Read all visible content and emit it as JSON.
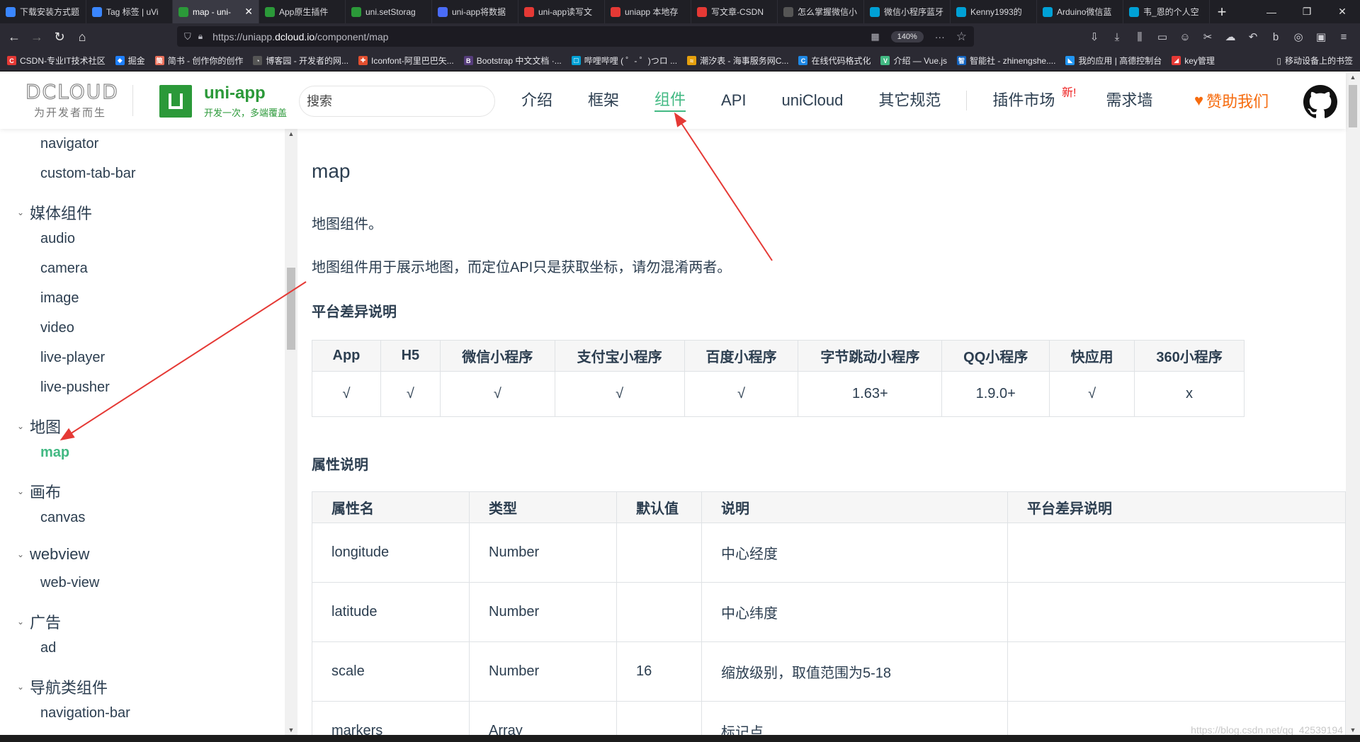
{
  "browser": {
    "tabs": [
      {
        "title": "下载安装方式题",
        "icon_color": "#3a86ff",
        "icon": "shield-icon"
      },
      {
        "title": "Tag 标签 | uVi",
        "icon_color": "#3a86ff",
        "icon": "shield-icon"
      },
      {
        "title": "map - uni-",
        "icon_color": "#2b9939",
        "icon": "uniapp-icon",
        "active": true
      },
      {
        "title": "App原生插件",
        "icon_color": "#2b9939",
        "icon": "uniapp-icon"
      },
      {
        "title": "uni.setStorag",
        "icon_color": "#2b9939",
        "icon": "uniapp-icon"
      },
      {
        "title": "uni-app将数据",
        "icon_color": "#4a6cf7",
        "icon": "paw-icon"
      },
      {
        "title": "uni-app读写文",
        "icon_color": "#e53935",
        "icon": "csdn-icon"
      },
      {
        "title": "uniapp 本地存",
        "icon_color": "#e53935",
        "icon": "csdn-icon"
      },
      {
        "title": "写文章-CSDN",
        "icon_color": "#e53935",
        "icon": "csdn-icon"
      },
      {
        "title": "怎么掌握微信小",
        "icon_color": "#555555",
        "icon": "hat-icon"
      },
      {
        "title": "微信小程序蓝牙",
        "icon_color": "#00a1d6",
        "icon": "bilibili-icon"
      },
      {
        "title": "Kenny1993的",
        "icon_color": "#00a1d6",
        "icon": "bilibili-icon"
      },
      {
        "title": "Arduino微信蓝",
        "icon_color": "#00a1d6",
        "icon": "bilibili-icon"
      },
      {
        "title": "韦_恩的个人空",
        "icon_color": "#00a1d6",
        "icon": "bilibili-icon"
      }
    ],
    "active_tab_close": "✕",
    "new_tab": "+",
    "window_controls": [
      "—",
      "❐",
      "✕"
    ],
    "nav": {
      "back": "←",
      "forward": "→",
      "reload": "↻",
      "home": "⌂"
    },
    "url_prefix": "https://uniapp.",
    "url_domain": "dcloud.io",
    "url_path": "/component/map",
    "zoom": "140%",
    "page_actions": "···",
    "bookmark_star": "☆",
    "toolbar_icons": [
      "⇩",
      "⤓",
      "⫼",
      "▭",
      "☺",
      "✂",
      "☁",
      "↶",
      "b",
      "◎",
      "▣",
      "≡"
    ],
    "bookmarks": [
      {
        "label": "CSDN-专业IT技术社区",
        "color": "#e53935",
        "glyph": "C"
      },
      {
        "label": "掘金",
        "color": "#1e80ff",
        "glyph": "◆"
      },
      {
        "label": "简书 - 创作你的创作",
        "color": "#ea6f5a",
        "glyph": "简"
      },
      {
        "label": "博客园 - 开发者的网...",
        "color": "#555555",
        "glyph": "◔"
      },
      {
        "label": "Iconfont-阿里巴巴矢...",
        "color": "#e34f2f",
        "glyph": "✚"
      },
      {
        "label": "Bootstrap 中文文档 ·...",
        "color": "#563d7c",
        "glyph": "B"
      },
      {
        "label": "哔哩哔哩 ( ゜- ゜)つロ ...",
        "color": "#00a1d6",
        "glyph": "▢"
      },
      {
        "label": "潮汐表 - 海事服务网C...",
        "color": "#e5a00d",
        "glyph": "≈"
      },
      {
        "label": "在线代码格式化",
        "color": "#1e88e5",
        "glyph": "C"
      },
      {
        "label": "介绍 — Vue.js",
        "color": "#42b983",
        "glyph": "V"
      },
      {
        "label": "智能社 - zhinengshe....",
        "color": "#1565c0",
        "glyph": "智"
      },
      {
        "label": "我的应用 | 高德控制台",
        "color": "#2196f3",
        "glyph": "◣"
      },
      {
        "label": "key管理",
        "color": "#e53935",
        "glyph": "◢"
      }
    ],
    "mobile_bookmarks": "移动设备上的书签"
  },
  "site": {
    "dcloud_wordmark": "DCLOUD",
    "dcloud_slogan": "为开发者而生",
    "brand_name": "uni-app",
    "brand_tagline": "开发一次，多端覆盖",
    "search_placeholder": "搜索",
    "nav": [
      "介绍",
      "框架",
      "组件",
      "API",
      "uniCloud",
      "其它规范"
    ],
    "active_nav": "组件",
    "plugin_market": "插件市场",
    "new_badge": "新!",
    "demand_wall": "需求墙",
    "sponsor_icon": "♥",
    "sponsor": "赞助我们",
    "accent_color": "#42b983",
    "brand_color": "#2b9939"
  },
  "sidebar": {
    "leaves_top": [
      "navigator",
      "custom-tab-bar"
    ],
    "groups": [
      {
        "title": "媒体组件",
        "items": [
          "audio",
          "camera",
          "image",
          "video",
          "live-player",
          "live-pusher"
        ]
      },
      {
        "title": "地图",
        "items": [
          "map"
        ]
      },
      {
        "title": "画布",
        "items": [
          "canvas"
        ]
      },
      {
        "title": "webview",
        "items": [
          "web-view"
        ]
      },
      {
        "title": "广告",
        "items": [
          "ad"
        ]
      },
      {
        "title": "导航类组件",
        "items": [
          "navigation-bar"
        ]
      }
    ],
    "active_item": "map"
  },
  "content": {
    "title": "map",
    "intro": "地图组件。",
    "description": "地图组件用于展示地图，而定位API只是获取坐标，请勿混淆两者。",
    "platform_heading": "平台差异说明",
    "platform_table": {
      "headers": [
        "App",
        "H5",
        "微信小程序",
        "支付宝小程序",
        "百度小程序",
        "字节跳动小程序",
        "QQ小程序",
        "快应用",
        "360小程序"
      ],
      "values": [
        "√",
        "√",
        "√",
        "√",
        "√",
        "1.63+",
        "1.9.0+",
        "√",
        "x"
      ]
    },
    "props_heading": "属性说明",
    "props_table": {
      "headers": [
        "属性名",
        "类型",
        "默认值",
        "说明",
        "平台差异说明"
      ],
      "rows": [
        [
          "longitude",
          "Number",
          "",
          "中心经度",
          ""
        ],
        [
          "latitude",
          "Number",
          "",
          "中心纬度",
          ""
        ],
        [
          "scale",
          "Number",
          "16",
          "缩放级别，取值范围为5-18",
          ""
        ],
        [
          "markers",
          "Array",
          "",
          "标记点",
          ""
        ]
      ]
    }
  },
  "watermark": "https://blog.csdn.net/qq_42539194",
  "annotation_color": "#e53935"
}
